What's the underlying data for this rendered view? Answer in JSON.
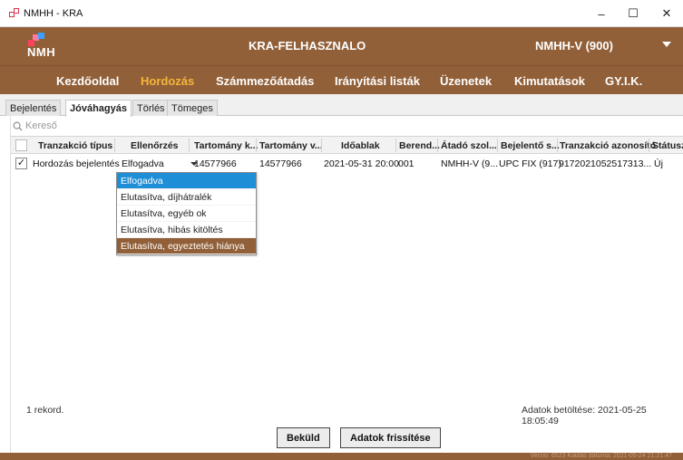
{
  "window": {
    "title": "NMHH - KRA",
    "minimize": "–",
    "maximize": "☐",
    "close": "✕"
  },
  "header": {
    "logo_text": "NMH",
    "user": "KRA-FELHASZNALO",
    "organization": "NMHH-V (900)"
  },
  "menu": [
    "Kezdőoldal",
    "Hordozás",
    "Számmezőátadás",
    "Irányítási listák",
    "Üzenetek",
    "Kimutatások",
    "GY.I.K."
  ],
  "menu_active": "Hordozás",
  "subtabs": [
    "Bejelentés",
    "Jóváhagyás",
    "Törlés",
    "Tömeges"
  ],
  "subtab_active": "Jóváhagyás",
  "search": {
    "placeholder": "Kereső"
  },
  "columns": [
    "Tranzakció típus",
    "Ellenőrzés",
    "Tartomány k...",
    "Tartomány v...",
    "Időablak",
    "Berend...",
    "Átadó szol...",
    "Bejelentő s...",
    "Tranzakció azonosító",
    "Státusz"
  ],
  "rows": [
    {
      "checked": "✓",
      "tranzakcio_tipus": "Hordozás bejelentés",
      "ellenorzes": "Elfogadva",
      "tartomany_k": "14577966",
      "tartomany_v": "14577966",
      "idoablak": "2021-05-31 20:00",
      "berend": "001",
      "atado": "NMHH-V (9...",
      "bejelento": "UPC FIX (917)",
      "azonosito": "9172021052517313...",
      "statusz": "Új"
    }
  ],
  "dropdown_options": [
    "Elfogadva",
    "Elutasítva, díjhátralék",
    "Elutasítva, egyéb ok",
    "Elutasítva, hibás kitöltés",
    "Elutasítva, egyeztetés hiánya"
  ],
  "dropdown_selected": "Elfogadva",
  "dropdown_hover": "Elutasítva, egyeztetés hiánya",
  "footer": {
    "record_count": "1 rekord.",
    "loaded": "Adatok betöltése: 2021-05-25 18:05:49"
  },
  "buttons": {
    "submit": "Beküld",
    "refresh": "Adatok frissítése"
  },
  "version": "Verzió: 6523 Kiadás dátuma: 2021-05-24 21:21:47",
  "colors": {
    "brand_brown": "#916039",
    "active_menu": "#f4b63a",
    "selected_option": "#1e8ed6"
  }
}
